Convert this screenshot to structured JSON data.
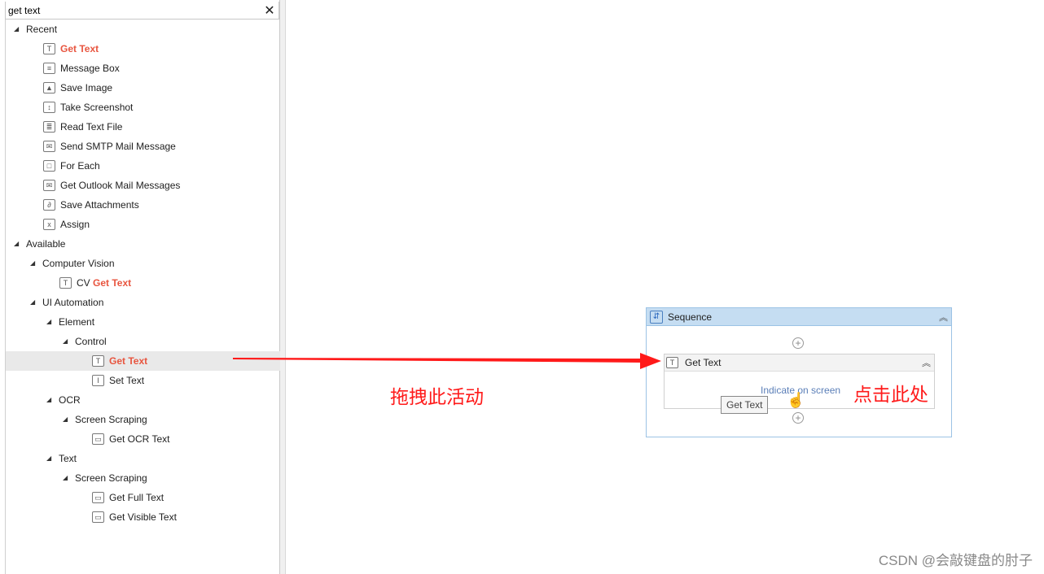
{
  "search": {
    "value": "get text",
    "clear_icon": "close-icon"
  },
  "tree": [
    {
      "type": "group",
      "depth": 0,
      "label": "Recent"
    },
    {
      "type": "leaf",
      "depth": 1,
      "icon": "get-text-icon",
      "glyph": "T",
      "match": "Get Text"
    },
    {
      "type": "leaf",
      "depth": 1,
      "icon": "message-box-icon",
      "glyph": "≡",
      "label": "Message Box"
    },
    {
      "type": "leaf",
      "depth": 1,
      "icon": "save-image-icon",
      "glyph": "▲",
      "label": "Save Image"
    },
    {
      "type": "leaf",
      "depth": 1,
      "icon": "take-screenshot-icon",
      "glyph": "↕",
      "label": "Take Screenshot"
    },
    {
      "type": "leaf",
      "depth": 1,
      "icon": "read-text-file-icon",
      "glyph": "≣",
      "label": "Read Text File"
    },
    {
      "type": "leaf",
      "depth": 1,
      "icon": "send-mail-icon",
      "glyph": "✉",
      "label": "Send SMTP Mail Message"
    },
    {
      "type": "leaf",
      "depth": 1,
      "icon": "for-each-icon",
      "glyph": "□",
      "label": "For Each"
    },
    {
      "type": "leaf",
      "depth": 1,
      "icon": "outlook-mail-icon",
      "glyph": "✉",
      "label": "Get Outlook Mail Messages"
    },
    {
      "type": "leaf",
      "depth": 1,
      "icon": "paperclip-icon",
      "glyph": "∂",
      "label": "Save Attachments"
    },
    {
      "type": "leaf",
      "depth": 1,
      "icon": "assign-icon",
      "glyph": "x",
      "label": "Assign"
    },
    {
      "type": "group",
      "depth": 0,
      "label": "Available"
    },
    {
      "type": "group",
      "depth": 1,
      "label": "Computer Vision"
    },
    {
      "type": "leaf",
      "depth": 2,
      "icon": "cv-get-text-icon",
      "glyph": "T",
      "label": "CV ",
      "match": "Get Text"
    },
    {
      "type": "group",
      "depth": 1,
      "label": "UI Automation"
    },
    {
      "type": "group",
      "depth": 2,
      "label": "Element"
    },
    {
      "type": "group",
      "depth": 3,
      "label": "Control"
    },
    {
      "type": "leaf",
      "depth": 4,
      "icon": "get-text-icon",
      "glyph": "T",
      "match": "Get Text",
      "selected": true
    },
    {
      "type": "leaf",
      "depth": 4,
      "icon": "set-text-icon",
      "glyph": "I",
      "label": "Set Text"
    },
    {
      "type": "group",
      "depth": 2,
      "label": "OCR"
    },
    {
      "type": "group",
      "depth": 3,
      "label": "Screen Scraping"
    },
    {
      "type": "leaf",
      "depth": 4,
      "icon": "monitor-icon",
      "glyph": "▭",
      "label": "Get OCR Text"
    },
    {
      "type": "group",
      "depth": 2,
      "label": "Text"
    },
    {
      "type": "group",
      "depth": 3,
      "label": "Screen Scraping"
    },
    {
      "type": "leaf",
      "depth": 4,
      "icon": "monitor-icon",
      "glyph": "▭",
      "label": "Get Full Text"
    },
    {
      "type": "leaf",
      "depth": 4,
      "icon": "monitor-icon",
      "glyph": "▭",
      "label": "Get Visible Text"
    }
  ],
  "canvas": {
    "sequence_title": "Sequence",
    "activity_title": "Get Text",
    "indicate_link": "Indicate on screen",
    "tooltip": "Get Text",
    "annotation_drag": "拖拽此活动",
    "annotation_click": "点击此处",
    "watermark": "CSDN @会敲键盘的肘子"
  },
  "colors": {
    "highlight": "#e8553f",
    "annotation": "#ff1a1a",
    "sequence_header": "#c5ddf2"
  }
}
